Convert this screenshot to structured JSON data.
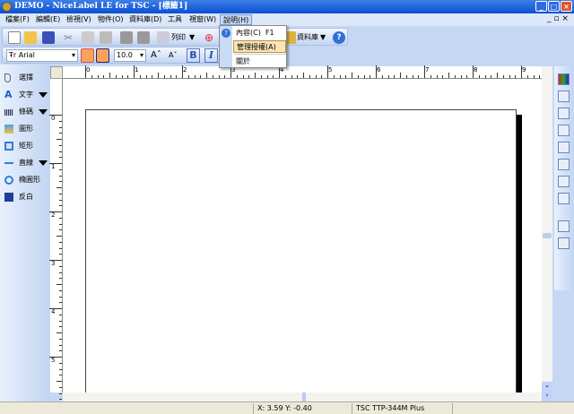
{
  "window": {
    "title": "DEMO - NiceLabel LE for TSC - [標籤1]"
  },
  "menubar": [
    "檔案(F)",
    "編輯(E)",
    "檢視(V)",
    "物件(O)",
    "資料庫(D)",
    "工具",
    "視窗(W)",
    "說明(H)"
  ],
  "help_menu": {
    "items": [
      {
        "label": "內容(C)",
        "shortcut": "F1"
      },
      {
        "label": "管理授權(A)"
      },
      {
        "label": "關於"
      }
    ]
  },
  "toolbar": {
    "print_label": "列印",
    "database_label": "資料庫"
  },
  "format_toolbar": {
    "font": "Arial",
    "size": "10.0",
    "bold": "B",
    "italic": "I"
  },
  "sidebar": {
    "items": [
      "選擇",
      "文字",
      "條碼",
      "圖形",
      "矩形",
      "直線",
      "橢圓形",
      "反白"
    ]
  },
  "ruler": {
    "h": [
      "0",
      "1",
      "2",
      "3",
      "4",
      "5",
      "6",
      "7",
      "8",
      "9"
    ],
    "v": [
      "0",
      "1",
      "2",
      "3",
      "4",
      "5"
    ]
  },
  "status": {
    "coords": "X: 3.59 Y: -0.40",
    "printer": "TSC  TTP-344M Plus"
  }
}
